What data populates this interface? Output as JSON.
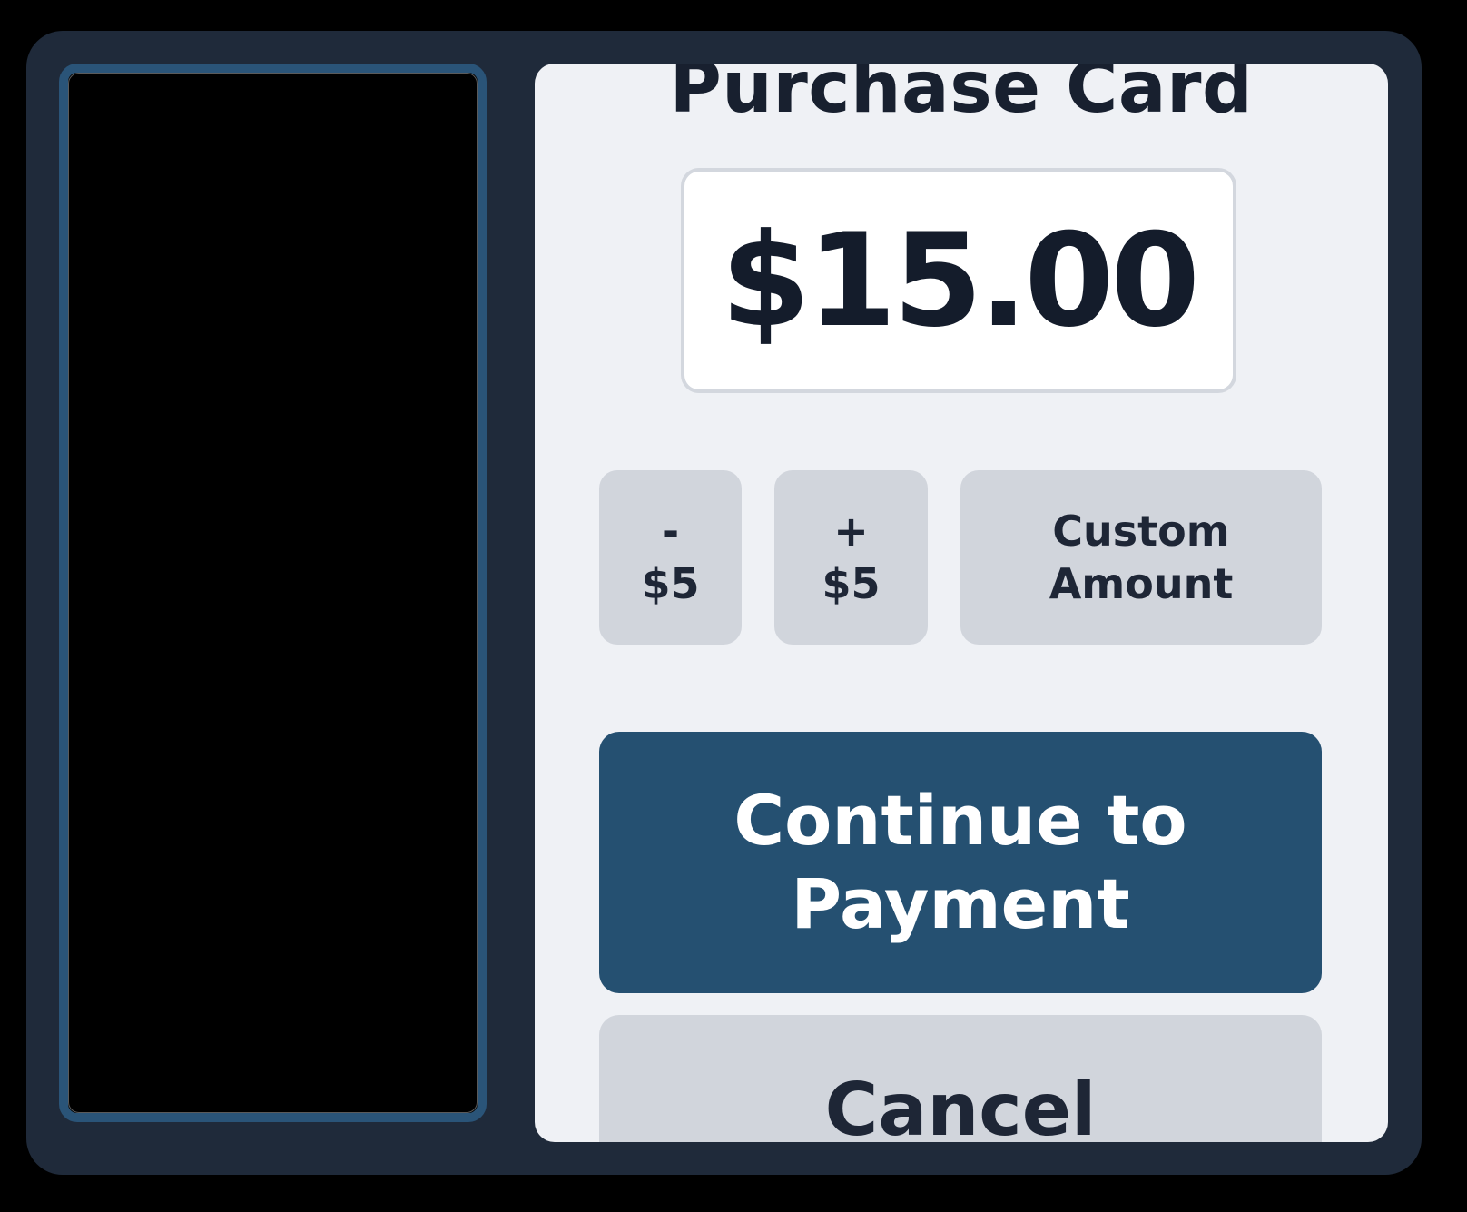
{
  "panel": {
    "title": "Purchase Card",
    "amount": "$15.00"
  },
  "adjust_buttons": {
    "minus": {
      "line1": "-",
      "line2": "$5"
    },
    "plus": {
      "line1": "+",
      "line2": "$5"
    },
    "custom": {
      "line1": "Custom",
      "line2": "Amount"
    }
  },
  "actions": {
    "continue_line1": "Continue to",
    "continue_line2": "Payment",
    "cancel": "Cancel"
  },
  "colors": {
    "background": "#000000",
    "device": "#1f2a3a",
    "card_border": "#2a5478",
    "panel": "#eff1f5",
    "primary": "#255071",
    "secondary": "#d1d5dc",
    "text_dark": "#18202f"
  }
}
